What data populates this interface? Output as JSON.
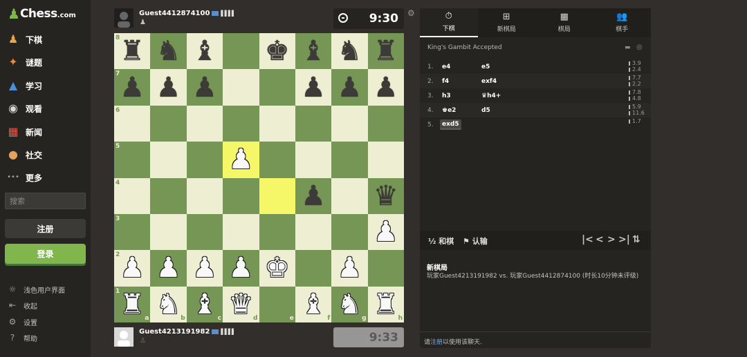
{
  "logo": {
    "text": "Chess",
    "domain": ".com"
  },
  "sidebar": {
    "nav": [
      {
        "name": "play",
        "label": "下棋",
        "icon": "pawn-icon",
        "glyph": "♟",
        "color": "#e9a44b"
      },
      {
        "name": "puzzles",
        "label": "谜题",
        "icon": "puzzle-icon",
        "glyph": "✦",
        "color": "#f0863a"
      },
      {
        "name": "learn",
        "label": "学习",
        "icon": "graduation-cap-icon",
        "glyph": "▲",
        "color": "#4b8fd6"
      },
      {
        "name": "watch",
        "label": "观看",
        "icon": "binoculars-icon",
        "glyph": "◉",
        "color": "#d8d8d8"
      },
      {
        "name": "news",
        "label": "新闻",
        "icon": "newspaper-icon",
        "glyph": "▦",
        "color": "#e05a4b"
      },
      {
        "name": "social",
        "label": "社交",
        "icon": "people-icon",
        "glyph": "●",
        "color": "#e7a25a"
      },
      {
        "name": "more",
        "label": "更多",
        "icon": "dots-icon",
        "glyph": "•••",
        "color": "#a5a3a1"
      }
    ],
    "search_placeholder": "搜索",
    "register_label": "注册",
    "login_label": "登录",
    "bottom": [
      {
        "name": "light-ui",
        "label": "浅色用户界面",
        "icon": "sun-icon",
        "glyph": "☼"
      },
      {
        "name": "collapse",
        "label": "收起",
        "icon": "collapse-arrow-icon",
        "glyph": "⇤"
      },
      {
        "name": "settings",
        "label": "设置",
        "icon": "gear-icon",
        "glyph": "⚙"
      },
      {
        "name": "help",
        "label": "帮助",
        "icon": "help-icon",
        "glyph": "?"
      }
    ]
  },
  "top_player": {
    "name": "Guest4412874100",
    "clock": "9:30"
  },
  "bottom_player": {
    "name": "Guest4213191982",
    "clock": "9:33"
  },
  "board": {
    "ranks": [
      "8",
      "7",
      "6",
      "5",
      "4",
      "3",
      "2",
      "1"
    ],
    "files": [
      "a",
      "b",
      "c",
      "d",
      "e",
      "f",
      "g",
      "h"
    ],
    "position": [
      [
        "r",
        "n",
        "b",
        "",
        "k",
        "b",
        "n",
        "r"
      ],
      [
        "p",
        "p",
        "p",
        "",
        "",
        "p",
        "p",
        "p"
      ],
      [
        "",
        "",
        "",
        "",
        "",
        "",
        "",
        ""
      ],
      [
        "",
        "",
        "",
        "P",
        "",
        "",
        "",
        ""
      ],
      [
        "",
        "",
        "",
        "",
        "",
        "p",
        "",
        "q"
      ],
      [
        "",
        "",
        "",
        "",
        "",
        "",
        "",
        "P"
      ],
      [
        "P",
        "P",
        "P",
        "P",
        "",
        "",
        "P",
        ""
      ],
      [
        "R",
        "N",
        "B",
        "Q",
        "",
        "B",
        "N",
        "R"
      ]
    ],
    "king_e2": "K",
    "highlight": [
      "d5",
      "e4"
    ],
    "colors": {
      "light": "#eeeed2",
      "dark": "#769656",
      "highlight": "#f6f669"
    }
  },
  "panel": {
    "tabs": [
      {
        "name": "play",
        "label": "下棋",
        "icon": "stopwatch-icon",
        "glyph": "⏱"
      },
      {
        "name": "new-game",
        "label": "新棋局",
        "icon": "plus-square-icon",
        "glyph": "⊞"
      },
      {
        "name": "games",
        "label": "棋局",
        "icon": "board-icon",
        "glyph": "▦"
      },
      {
        "name": "players",
        "label": "棋手",
        "icon": "players-icon",
        "glyph": "👥"
      }
    ],
    "opening": "King's Gambit Accepted",
    "moves": [
      {
        "num": "1.",
        "white": "e4",
        "black": "e5",
        "t1": "3.9",
        "t2": "2.4"
      },
      {
        "num": "2.",
        "white": "f4",
        "black": "exf4",
        "t1": "7.7",
        "t2": "2.2"
      },
      {
        "num": "3.",
        "white": "h3",
        "black": "♛h4+",
        "t1": "7.8",
        "t2": "4.8"
      },
      {
        "num": "4.",
        "white": "♚e2",
        "black": "d5",
        "t1": "5.9",
        "t2": "11.6"
      },
      {
        "num": "5.",
        "white": "exd5",
        "black": "",
        "t1": "1.7",
        "t2": ""
      }
    ],
    "draw_label": "½  和棋",
    "resign_label": "⚑  认输",
    "game_title": "新棋局",
    "game_desc": "玩家Guest4213191982 vs. 玩家Guest4412874100 (时长10分钟未评级)",
    "chat_pre": "请",
    "chat_link": "注册",
    "chat_post": "以使用该聊天."
  }
}
